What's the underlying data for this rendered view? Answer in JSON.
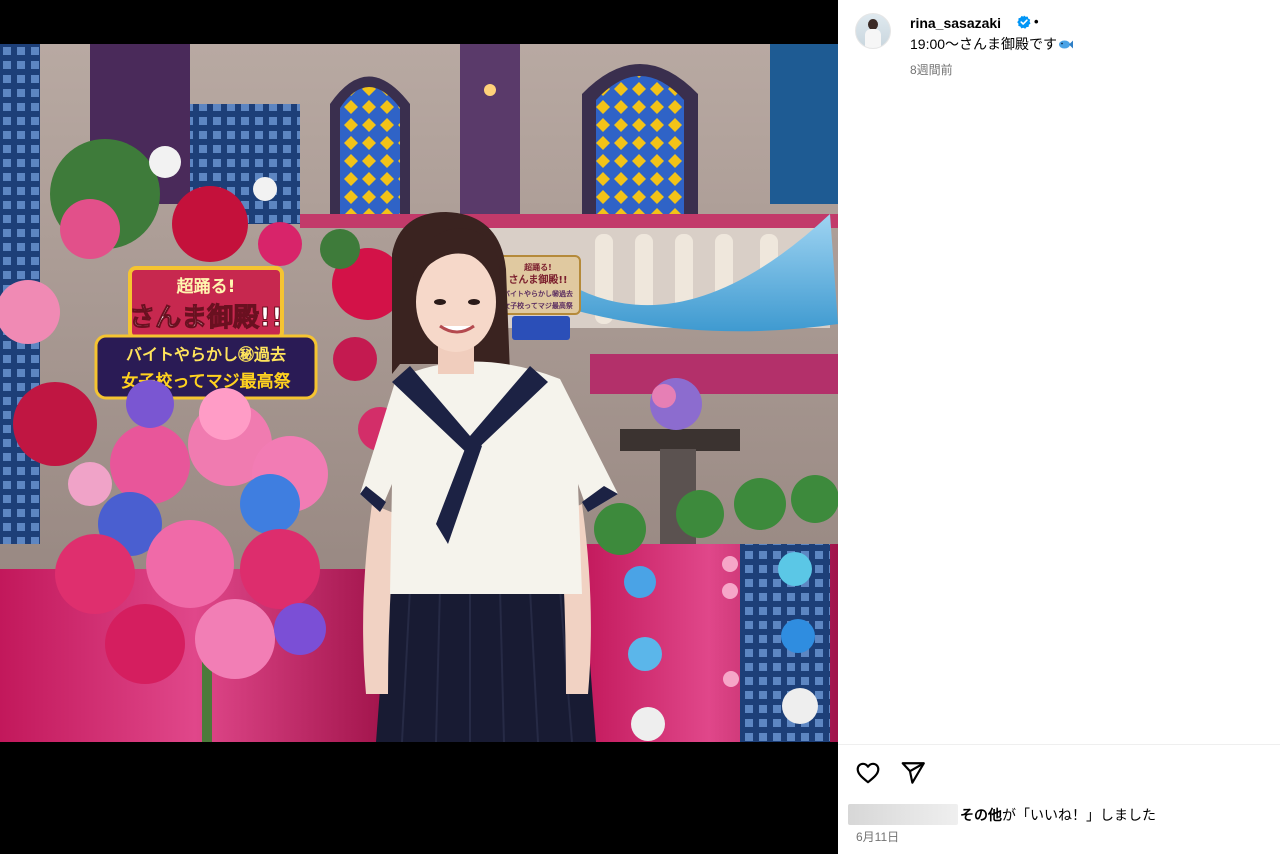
{
  "post": {
    "username": "rina_sasazaki",
    "separator": "•",
    "caption": "19:00〜さんま御殿です",
    "caption_emoji": "fish-emoji",
    "time_ago": "8週間前"
  },
  "photo": {
    "sign_main": {
      "line1": "超踊る!",
      "line2": "さんま御殿!!",
      "line3": "バイトやらかし㊙過去",
      "line4": "女子校ってマジ最高祭"
    },
    "sign_small": {
      "line1": "超踊る!",
      "line2": "さんま御殿!!",
      "line3": "バイトやらかし㊙過去",
      "line4": "女子校ってマジ最高祭"
    }
  },
  "actions": {
    "like_icon": "heart-outline-icon",
    "share_icon": "paper-plane-icon"
  },
  "likes": {
    "bold": "その他",
    "text": "が「いいね！」しました"
  },
  "date": "6月11日",
  "colors": {
    "verified": "#0095f6",
    "muted": "#737373",
    "media_bg": "#000000"
  }
}
